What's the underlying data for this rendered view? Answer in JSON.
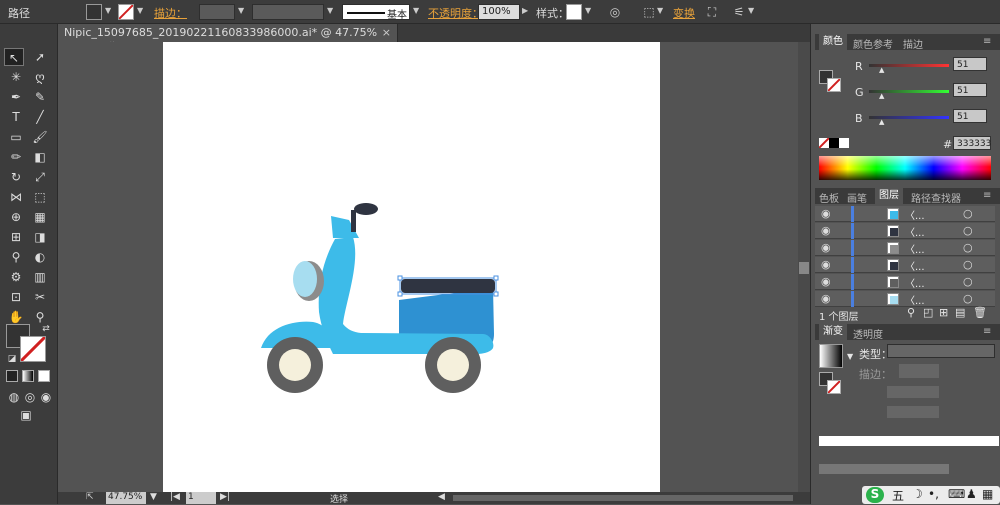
{
  "control_bar": {
    "path_label": "路径",
    "stroke_label": "描边：",
    "stroke_style": "基本",
    "opacity_label": "不透明度：",
    "opacity_value": "100%",
    "style_label": "样式：",
    "transform_label": "变换"
  },
  "document_tab": {
    "title": "Nipic_15097685_20190221160833986000.ai* @ 47.75% (RGB/预览)",
    "close": "×"
  },
  "status_bar": {
    "zoom": "47.75%",
    "page": "1",
    "tool_status": "选择"
  },
  "color_panel": {
    "tabs": [
      "颜色",
      "颜色参考",
      "描边"
    ],
    "channels": [
      {
        "label": "R",
        "value": "51"
      },
      {
        "label": "G",
        "value": "51"
      },
      {
        "label": "B",
        "value": "51"
      }
    ],
    "hex_label": "#",
    "hex_value": "333333"
  },
  "layers_panel": {
    "tabs": [
      "色板",
      "画笔",
      "图层",
      "路径查找器"
    ],
    "layer_label": "〈...",
    "footer": "1 个图层",
    "rows": 6
  },
  "gradient_panel": {
    "tabs": [
      "渐变",
      "透明度"
    ],
    "type_label": "类型：",
    "stroke_label": "描边："
  },
  "taskbar": {
    "ime": "五"
  },
  "colors": {
    "scooter_body": "#3dbbe9",
    "scooter_dark": "#2e91d2",
    "wheel": "#5f5f5f",
    "hub": "#f5f0dc",
    "seat": "#2f3441",
    "mirror": "#2f3441",
    "headlight": "#a7ddf0"
  }
}
